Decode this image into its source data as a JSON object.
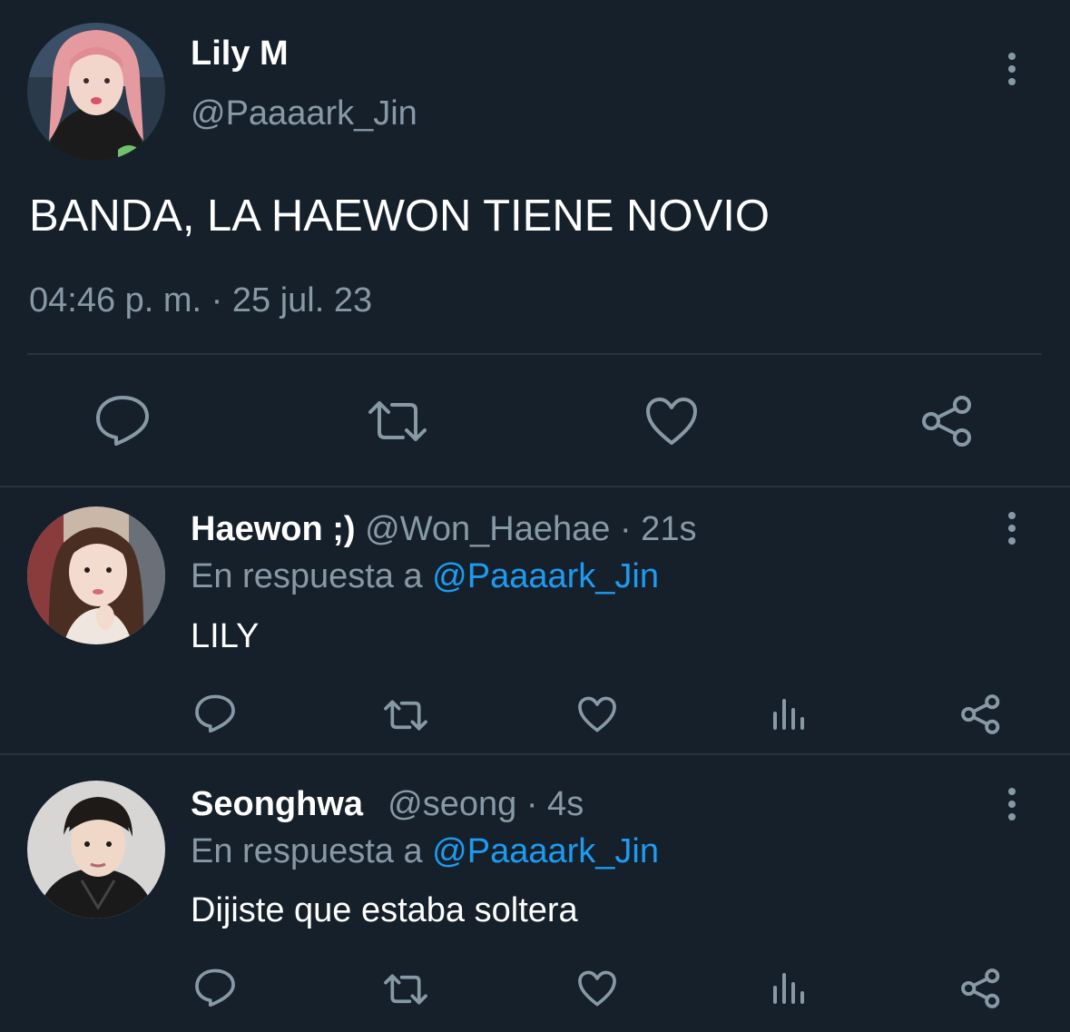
{
  "main_tweet": {
    "name": "Lily M",
    "handle": "@Paaaark_Jin",
    "text": "BANDA, LA HAEWON TIENE NOVIO",
    "timestamp": "04:46 p. m. · 25 jul. 23",
    "actions": [
      "reply-icon",
      "retweet-icon",
      "like-icon",
      "share-icon"
    ]
  },
  "replies": [
    {
      "name": "Haewon ;)",
      "handle": "@Won_Haehae",
      "time": "· 21s",
      "reply_prefix": "En respuesta a",
      "reply_to": "@Paaaark_Jin",
      "text": "LILY",
      "actions": [
        "reply-icon",
        "retweet-icon",
        "like-icon",
        "analytics-icon",
        "share-icon"
      ]
    },
    {
      "name": "Seonghwa",
      "handle": "@seong",
      "time": "· 4s",
      "reply_prefix": "En respuesta a",
      "reply_to": "@Paaaark_Jin",
      "text": "Dijiste que estaba soltera",
      "actions": [
        "reply-icon",
        "retweet-icon",
        "like-icon",
        "analytics-icon",
        "share-icon"
      ]
    }
  ],
  "colors": {
    "background": "#15202b",
    "divider": "#253341",
    "muted_text": "#8899a6",
    "link": "#1d9bf0",
    "text": "#ffffff"
  }
}
